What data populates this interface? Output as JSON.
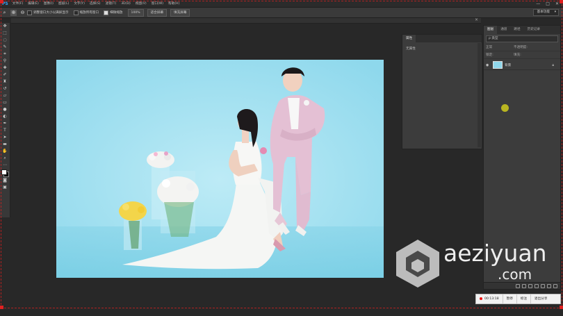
{
  "app": {
    "logo": "PS"
  },
  "menu": [
    "文件(F)",
    "编辑(E)",
    "图像(I)",
    "图层(L)",
    "文字(Y)",
    "选择(S)",
    "滤镜(T)",
    "3D(D)",
    "视图(V)",
    "窗口(W)",
    "帮助(H)"
  ],
  "window_controls": [
    "—",
    "□",
    "✕"
  ],
  "options": {
    "resize_windows": "调整窗口大小以满屏显示",
    "zoom_all": "缩放所有窗口",
    "scrubby_zoom": "细微缩放",
    "zoom_value": "100%",
    "fit_screen": "适合屏幕",
    "fill_screen": "填充屏幕",
    "workspace": "基本功能"
  },
  "properties_panel": {
    "tab": "属性",
    "content": "无属性"
  },
  "layers_panel": {
    "tabs": [
      "图层",
      "通道",
      "路径",
      "历史记录"
    ],
    "filter_kind": "ρ 类型",
    "blend_mode": "正常",
    "opacity_label": "不透明度:",
    "lock_label": "锁定:",
    "fill_label": "填充:",
    "layer_name": "背景"
  },
  "watermark": {
    "line1": "aeziyuan",
    "line2": ".com"
  },
  "recording": {
    "time": "00:13:18",
    "items": [
      "暂停",
      "标注",
      "退出分享"
    ]
  },
  "colors": {
    "accent": "#31a8ff",
    "backdrop": "#a6e3f1",
    "suit": "#e2bfd3",
    "record": "#e11111"
  },
  "icons": {
    "toolbar": [
      "move-icon",
      "marquee-icon",
      "lasso-icon",
      "quick-select-icon",
      "crop-icon",
      "eyedropper-icon",
      "healing-icon",
      "brush-icon",
      "stamp-icon",
      "history-brush-icon",
      "eraser-icon",
      "gradient-icon",
      "blur-icon",
      "dodge-icon",
      "pen-icon",
      "type-icon",
      "path-select-icon",
      "shape-icon",
      "hand-icon",
      "zoom-icon",
      "more-icon"
    ]
  }
}
